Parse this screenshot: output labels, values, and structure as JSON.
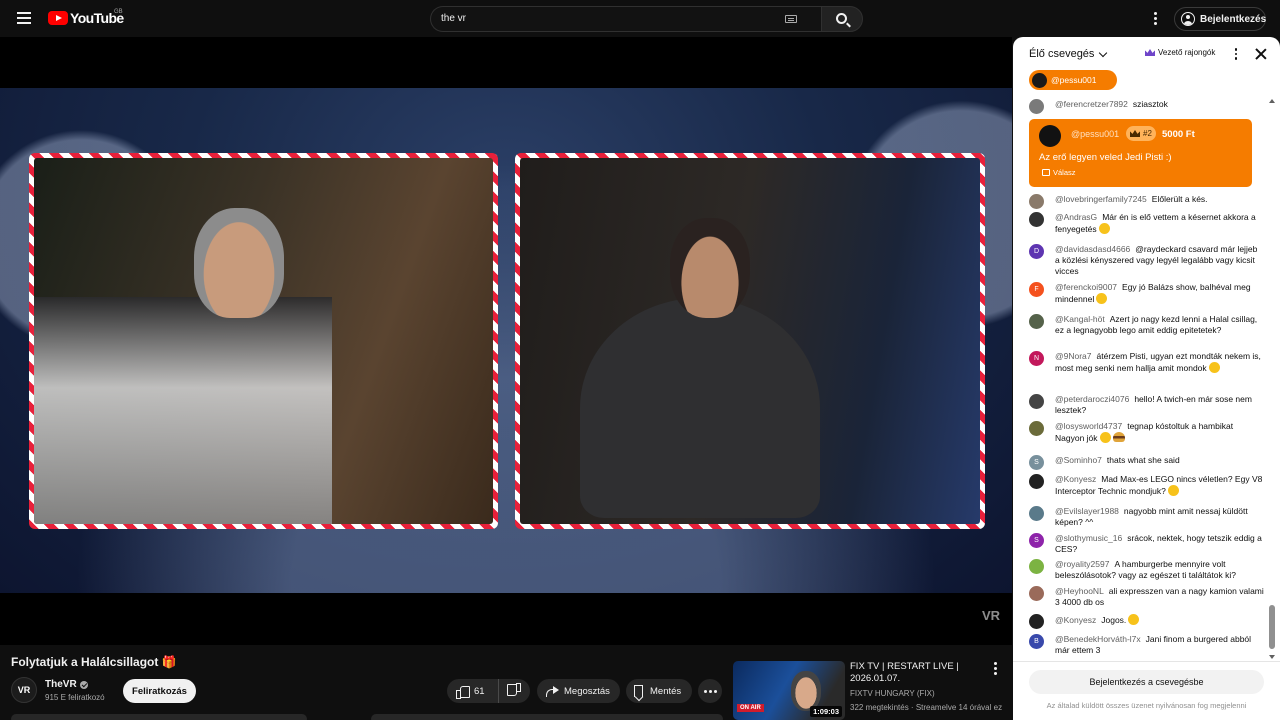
{
  "topbar": {
    "logo_text": "YouTube",
    "country_code": "GB",
    "search_value": "the vr",
    "signin_label": "Bejelentkezés"
  },
  "player": {
    "watermark": "VR"
  },
  "video": {
    "title": "Folytatjuk a Halálcsillagot 🎁",
    "channel_initials": "VR",
    "channel_name": "TheVR",
    "subscribers": "915 E feliratkozó",
    "subscribe_label": "Feliratkozás",
    "like_count": "61",
    "share_label": "Megosztás",
    "save_label": "Mentés"
  },
  "recommended": {
    "title": "FIX TV | RESTART LIVE | 2026.01.07.",
    "channel": "FIXTV HUNGARY (FIX)",
    "meta": "322 megtekintés · Streamelve 14 órával ezelőtt",
    "duration": "1:09:03",
    "badge": "ON AIR"
  },
  "chat": {
    "mode_label": "Élő csevegés",
    "top_fans_label": "Vezető rajongók",
    "ticker_name": "@pessu001",
    "superchat": {
      "author": "@pessu001",
      "badge": "#2",
      "amount": "5000 Ft",
      "text": "Az erő legyen veled Jedi Pisti :)",
      "reply_label": "Válasz"
    },
    "messages": [
      {
        "initial": "",
        "author": "@ferencretzer7892",
        "text": "sziasztok"
      },
      {
        "initial": "",
        "author": "@lovebringerfamily7245",
        "text": "Előlerült a kés."
      },
      {
        "initial": "",
        "author": "@AndrasG",
        "text": "Már én is elő vettem a késernet akkora a fenyegetés"
      },
      {
        "initial": "D",
        "author": "@davidasdasd4666",
        "text": "@raydeckard csavard már lejjeb a közlési kényszered vagy legyél legalább vagy kicsit vicces"
      },
      {
        "initial": "F",
        "author": "@ferenckoi9007",
        "text": "Egy jó Balázs show, balhéval meg mindennel"
      },
      {
        "initial": "",
        "author": "@Kangal-höt",
        "text": "Azert jo nagy kezd lenni a Halal csillag, ez a legnagyobb lego amit eddig epitetetek?"
      },
      {
        "initial": "N",
        "author": "@9Nora7",
        "text": "átérzem Pisti, ugyan ezt mondták nekem is, most meg senki nem hallja amit mondok"
      },
      {
        "initial": "",
        "author": "@peterdaroczi4076",
        "text": "hello! A twich-en már sose nem lesztek?"
      },
      {
        "initial": "",
        "author": "@losysworld4737",
        "text": "tegnap kóstoltuk a hambikat Nagyon jók"
      },
      {
        "initial": "S",
        "author": "@Sominho7",
        "text": "thats what she said"
      },
      {
        "initial": "",
        "author": "@Konyesz",
        "text": "Mad Max-es LEGO nincs véletlen? Egy V8 Interceptor Technic mondjuk?"
      },
      {
        "initial": "",
        "author": "@Evilslayer1988",
        "text": "nagyobb mint amit nessaj küldött képen? ^^"
      },
      {
        "initial": "S",
        "author": "@slothymusic_16",
        "text": "srácok, nektek, hogy tetszik eddig a CES?"
      },
      {
        "initial": "",
        "author": "@royality2597",
        "text": "A hamburgerbe mennyire volt beleszólásotok? vagy az egészet ti találtátok ki?"
      },
      {
        "initial": "",
        "author": "@HeyhooNL",
        "text": "ali expresszen van a nagy kamion valami 3 4000 db os"
      },
      {
        "initial": "",
        "author": "@Konyesz",
        "text": "Jogos."
      },
      {
        "initial": "B",
        "author": "@BenedekHorváth-l7x",
        "text": "Jani finom a burgered abból már ettem 3"
      }
    ],
    "signin_label": "Bejelentkezés a csevegésbe",
    "disclaimer": "Az általad küldött összes üzenet nyilvánosan fog megjelenni"
  }
}
